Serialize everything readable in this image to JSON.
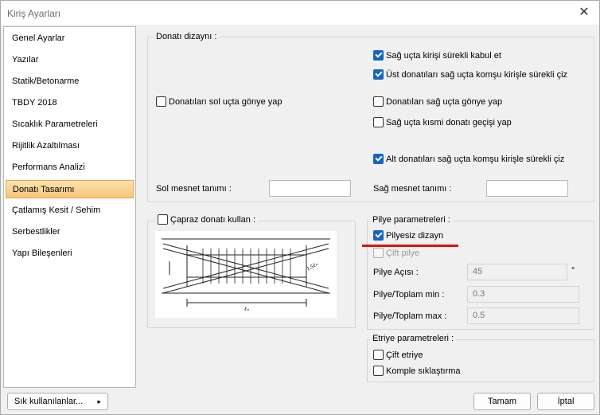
{
  "window": {
    "title": "Kiriş Ayarları",
    "close_glyph": "✕"
  },
  "sidebar": {
    "items": [
      {
        "label": "Genel Ayarlar",
        "active": false
      },
      {
        "label": "Yazılar",
        "active": false
      },
      {
        "label": "Statik/Betonarme",
        "active": false
      },
      {
        "label": "TBDY 2018",
        "active": false
      },
      {
        "label": "Sıcaklık Parametreleri",
        "active": false
      },
      {
        "label": "Rijitlik Azaltılması",
        "active": false
      },
      {
        "label": "Performans Analizi",
        "active": false
      },
      {
        "label": "Donatı Tasarımı",
        "active": true
      },
      {
        "label": "Çatlamış Kesit / Sehim",
        "active": false
      },
      {
        "label": "Serbestlikler",
        "active": false
      },
      {
        "label": "Yapı Bileşenleri",
        "active": false
      }
    ]
  },
  "donati": {
    "legend": "Donatı dizaynı :",
    "left_gonye": {
      "label": "Donatıları sol uçta gönye yap",
      "checked": false
    },
    "right_continuous": {
      "label": "Sağ uçta kirişi sürekli kabul et",
      "checked": true
    },
    "top_continuous": {
      "label": "Üst donatıları sağ uçta komşu kirişle sürekli çiz",
      "checked": true
    },
    "right_gonye": {
      "label": "Donatıları sağ uçta gönye yap",
      "checked": false
    },
    "partial_transition": {
      "label": "Sağ uçta kısmi donatı geçişi yap",
      "checked": false
    },
    "bottom_continuous": {
      "label": "Alt donatıları sağ uçta komşu kirişle sürekli çiz",
      "checked": true
    },
    "left_support_label": "Sol mesnet tanımı :",
    "left_support_value": "",
    "right_support_label": "Sağ mesnet tanımı :",
    "right_support_value": ""
  },
  "capraz": {
    "label": "Çapraz donatı kullan :",
    "checked": false,
    "diagram_labels": {
      "dim1": "1.5ℓₙ",
      "dim2": "ℓₙ"
    }
  },
  "pilye": {
    "legend": "Pilye parametreleri :",
    "pilyesiz": {
      "label": "Pilyesiz dizayn",
      "checked": true
    },
    "cift_pilye": {
      "label": "Çift pilye",
      "checked": true,
      "disabled": true
    },
    "angle_label": "Pilye Açısı :",
    "angle_value": "45",
    "angle_unit": "°",
    "min_label": "Pilye/Toplam min :",
    "min_value": "0.3",
    "max_label": "Pilye/Toplam max :",
    "max_value": "0.5"
  },
  "etriye": {
    "legend": "Etriye parametreleri :",
    "cift": {
      "label": "Çift etriye",
      "checked": false
    },
    "komple": {
      "label": "Komple sıklaştırma",
      "checked": false
    }
  },
  "footer": {
    "favorites_label": "Sık kullanılanlar...",
    "favorites_arrow": "▸",
    "ok_label": "Tamam",
    "cancel_label": "İptal"
  },
  "colors": {
    "accent": "#1565c0",
    "highlight": "#e01010",
    "active_item": "#f7c57a"
  }
}
